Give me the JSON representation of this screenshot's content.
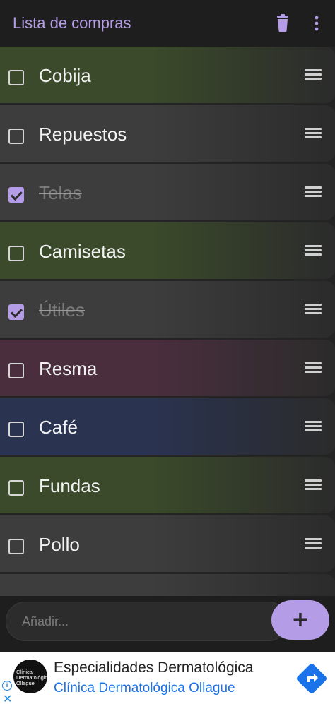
{
  "header": {
    "title": "Lista de compras",
    "trash_icon": "trash-icon",
    "menu_icon": "more-vert-icon"
  },
  "items": [
    {
      "label": "Cobija",
      "checked": false,
      "color": "#3a4a2a"
    },
    {
      "label": "Repuestos",
      "checked": false,
      "color": "#3d3d3d"
    },
    {
      "label": "Telas",
      "checked": true,
      "color": "#3d3d3d"
    },
    {
      "label": "Camisetas",
      "checked": false,
      "color": "#3a4a2a"
    },
    {
      "label": "Útiles",
      "checked": true,
      "color": "#3d3d3d"
    },
    {
      "label": "Resma",
      "checked": false,
      "color": "#4a2e3e"
    },
    {
      "label": "Café",
      "checked": false,
      "color": "#2a3350"
    },
    {
      "label": "Fundas",
      "checked": false,
      "color": "#3a4a2a"
    },
    {
      "label": "Pollo",
      "checked": false,
      "color": "#3d3d3d"
    },
    {
      "label": "",
      "checked": false,
      "color": "#3d3d3d"
    }
  ],
  "composer": {
    "placeholder": "Añadir...",
    "add_label": "+"
  },
  "ad": {
    "headline": "Especialidades Dermatológica",
    "advertiser": "Clínica Dermatológica Ollague",
    "logo_text": "Clínica Dermatológica Ollague",
    "info_icon": "info-icon",
    "close_label": "✕",
    "cta_icon": "directions-arrow-icon",
    "accent": "#1a73e8"
  }
}
